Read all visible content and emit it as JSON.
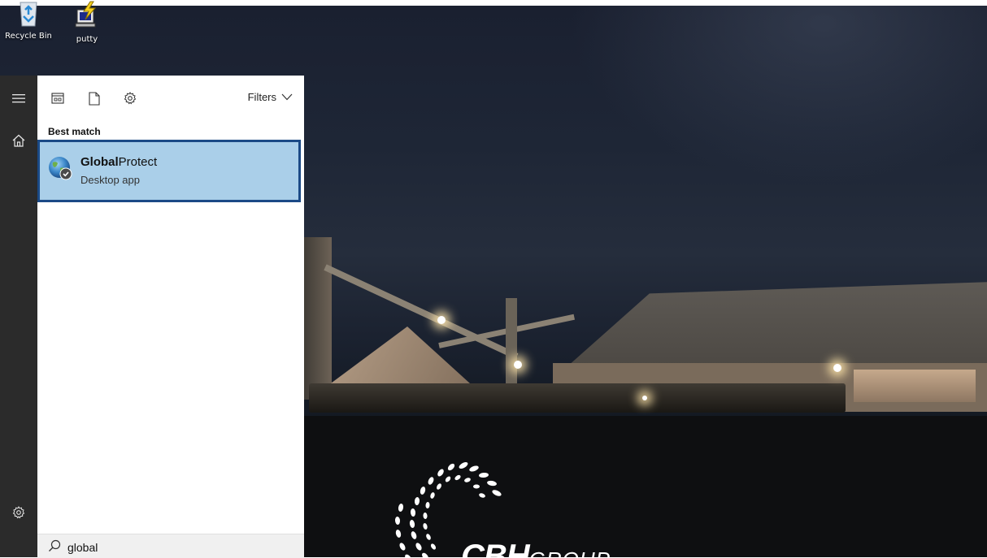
{
  "desktop": {
    "icons": [
      {
        "label": "Recycle Bin",
        "icon": "recycle-bin-icon"
      },
      {
        "label": "putty",
        "icon": "putty-icon"
      }
    ],
    "wallpaper_logo": {
      "main": "CBH",
      "suffix": "GROUP"
    }
  },
  "rail": {
    "items": [
      {
        "icon": "hamburger-menu-icon",
        "glyph": "≡"
      },
      {
        "icon": "home-icon",
        "glyph": "⌂"
      },
      {
        "icon": "settings-gear-icon",
        "glyph": "⚙"
      }
    ]
  },
  "search_panel": {
    "toolbar": {
      "tabs": [
        {
          "icon": "apps-icon"
        },
        {
          "icon": "documents-icon"
        },
        {
          "icon": "settings-icon"
        }
      ],
      "filters_label": "Filters",
      "filters_icon": "chevron-down-icon"
    },
    "best_match_label": "Best match",
    "best_match": {
      "title_bold": "Global",
      "title_rest": "Protect",
      "subtitle": "Desktop app",
      "icon": "globalprotect-globe-icon"
    },
    "search_box": {
      "value": "global",
      "icon": "search-icon"
    }
  },
  "colors": {
    "rail_bg": "#2b2b2b",
    "result_highlight": "#aacfe9",
    "result_border": "#1b4a86"
  }
}
